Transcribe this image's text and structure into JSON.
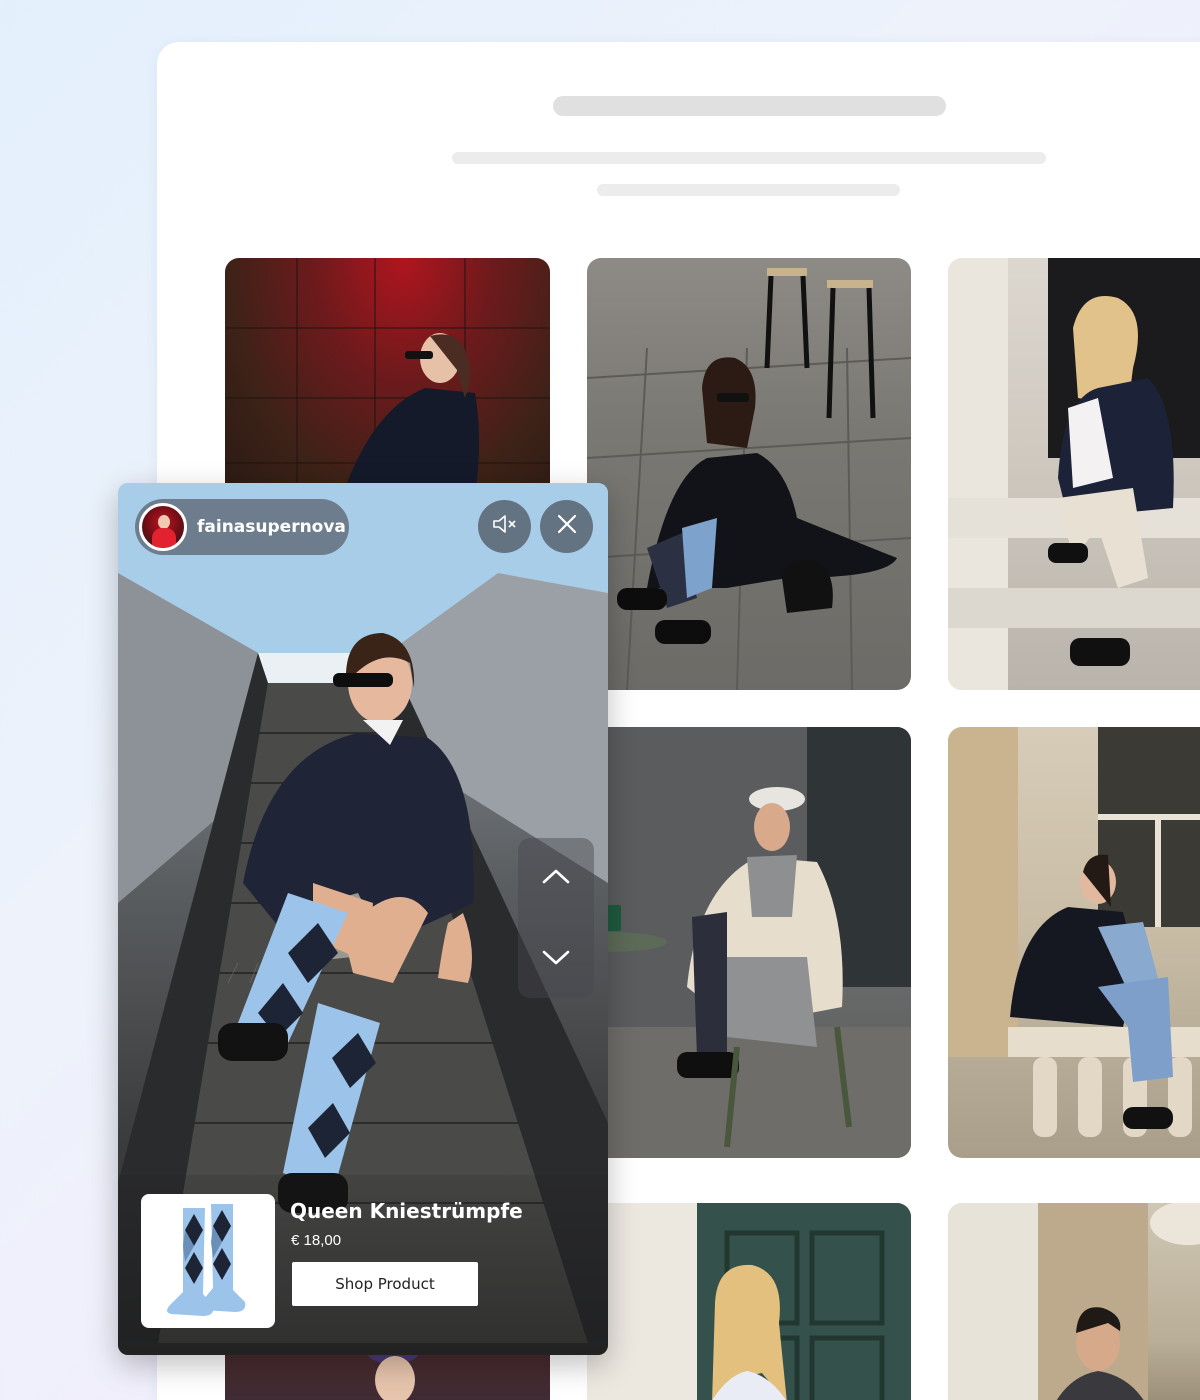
{
  "gallery": {
    "tiles": [
      {
        "name": "red-wall-seated-woman"
      },
      {
        "name": "street-sitting-woman-argyle"
      },
      {
        "name": "steps-smiling-woman"
      },
      {
        "name": "cafe-woman-cap"
      },
      {
        "name": "balustrade-woman-jeans"
      },
      {
        "name": "door-smiling-woman"
      },
      {
        "name": "storefront-man"
      },
      {
        "name": "woman-purple-beret"
      }
    ]
  },
  "story": {
    "username": "fainasupernova",
    "product": {
      "title": "Queen Kniestrümpfe",
      "price": "€ 18,00",
      "cta": "Shop Product"
    }
  },
  "colors": {
    "background_start": "#e3f0fc",
    "background_end": "#ece6fb",
    "card": "#ffffff",
    "skeleton": "#e0e0e0",
    "sock_light": "#9cc4ea",
    "sock_dark": "#1d2436"
  },
  "icons": {
    "mute": "speaker-muted-icon",
    "close": "close-icon",
    "up": "chevron-up-icon",
    "down": "chevron-down-icon"
  }
}
